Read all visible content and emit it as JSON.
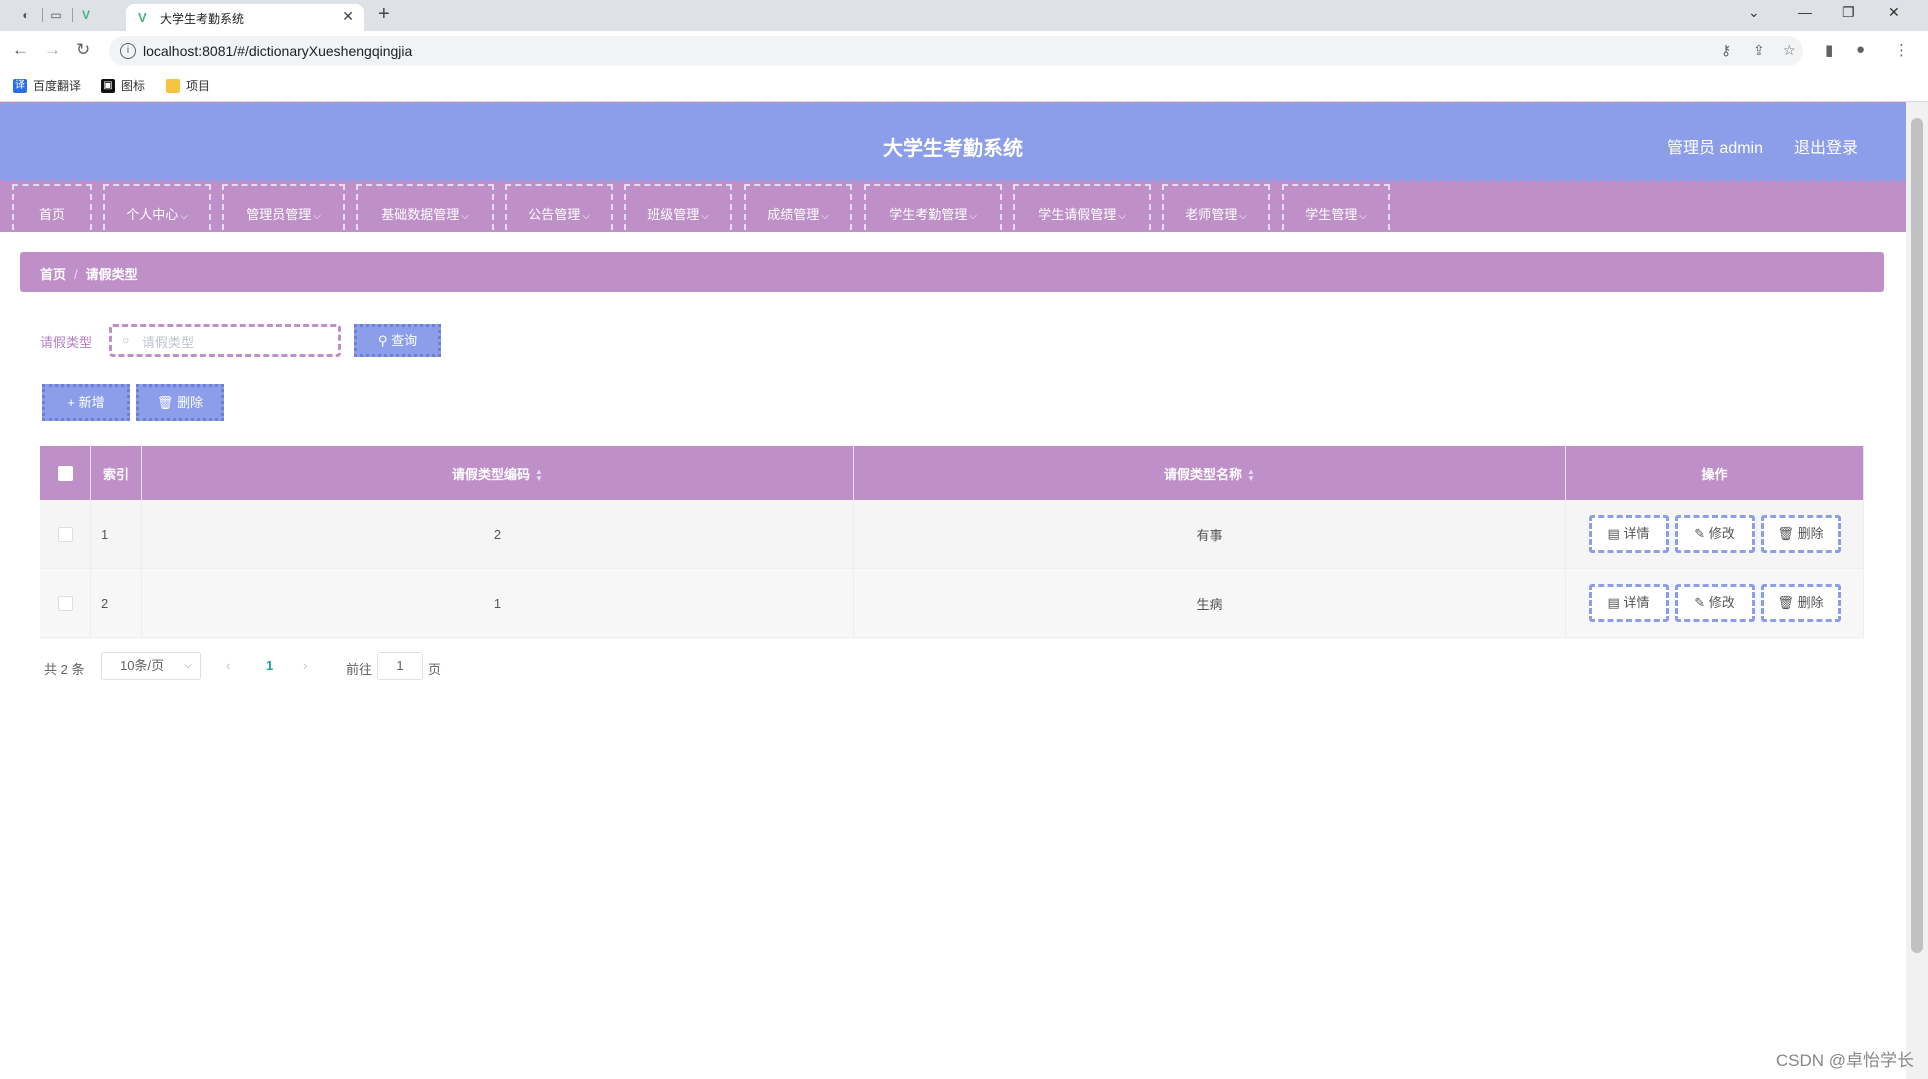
{
  "browser": {
    "tab_title": "大学生考勤系统",
    "url": "localhost:8081/#/dictionaryXueshengqingjia",
    "bookmarks": [
      "百度翻译",
      "图标",
      "项目"
    ]
  },
  "header": {
    "title": "大学生考勤系统",
    "user_label": "管理员 admin",
    "logout_label": "退出登录"
  },
  "menu": {
    "items": [
      "首页",
      "个人中心",
      "管理员管理",
      "基础数据管理",
      "公告管理",
      "班级管理",
      "成绩管理",
      "学生考勤管理",
      "学生请假管理",
      "老师管理",
      "学生管理"
    ]
  },
  "breadcrumb": {
    "home": "首页",
    "current": "请假类型"
  },
  "search": {
    "label": "请假类型",
    "placeholder": "请假类型",
    "value": "",
    "query_label": "查询"
  },
  "actions": {
    "add_label": "新增",
    "delete_label": "删除"
  },
  "table": {
    "headers": [
      "索引",
      "请假类型编码",
      "请假类型名称",
      "操作"
    ],
    "rows": [
      {
        "index": "1",
        "code": "2",
        "name": "有事"
      },
      {
        "index": "2",
        "code": "1",
        "name": "生病"
      }
    ],
    "row_actions": [
      "详情",
      "修改",
      "删除"
    ]
  },
  "pagination": {
    "total_text": "共 2 条",
    "page_size": "10条/页",
    "current_page": "1",
    "goto_label": "前往",
    "goto_value": "1",
    "page_suffix": "页"
  },
  "watermark": "CSDN @卓怡学长",
  "colors": {
    "header_bg": "#8c9eea",
    "menu_bg": "#bf90c8",
    "accent": "#b57ec6"
  }
}
